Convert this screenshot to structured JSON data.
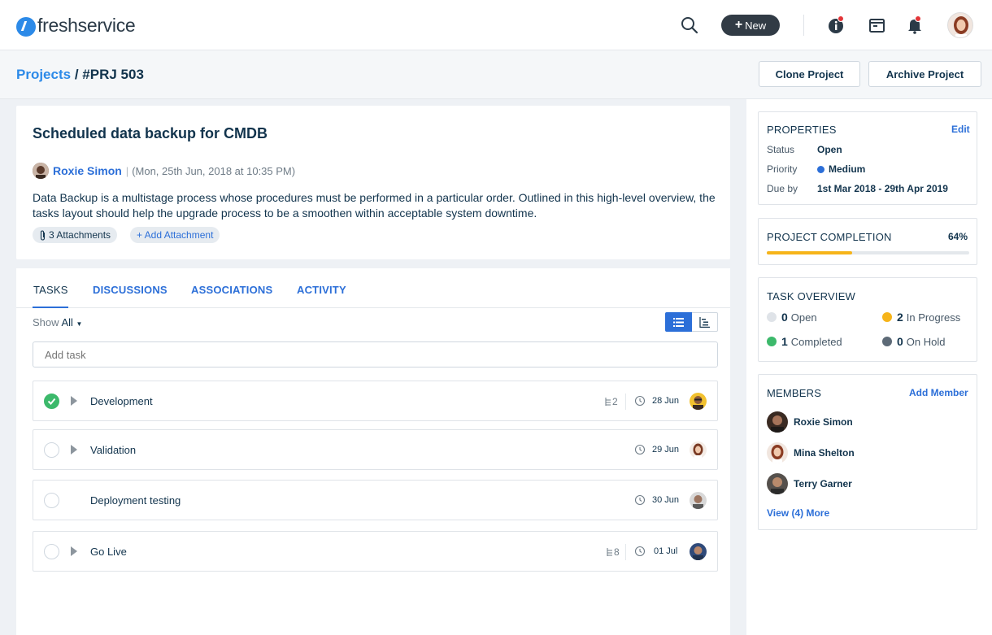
{
  "app": {
    "logo_text": "freshservice",
    "new_label": "New"
  },
  "breadcrumb": {
    "parent": "Projects",
    "separator": "/",
    "current": "#PRJ 503"
  },
  "actions": {
    "clone": "Clone Project",
    "archive": "Archive Project"
  },
  "project": {
    "title": "Scheduled data backup for CMDB",
    "author": "Roxie Simon",
    "separator": "|",
    "date": "(Mon, 25th Jun, 2018 at 10:35 PM)",
    "description": "Data Backup is a multistage process whose procedures must be performed in a particular order. Outlined in this high-level overview, the tasks layout should help the upgrade process to be a smoothen within acceptable system downtime.",
    "attachments": "3 Attachments",
    "add_attachment": "+ Add Attachment"
  },
  "tabs": [
    "TASKS",
    "DISCUSSIONS",
    "ASSOCIATIONS",
    "ACTIVITY"
  ],
  "tasks_panel": {
    "show_label": "Show",
    "show_value": "All",
    "add_placeholder": "Add task",
    "tasks": [
      {
        "name": "Development",
        "done": true,
        "expandable": true,
        "subtasks": "2",
        "date": "28 Jun"
      },
      {
        "name": "Validation",
        "done": false,
        "expandable": true,
        "subtasks": "",
        "date": "29 Jun"
      },
      {
        "name": "Deployment testing",
        "done": false,
        "expandable": false,
        "subtasks": "",
        "date": "30 Jun"
      },
      {
        "name": "Go Live",
        "done": false,
        "expandable": true,
        "subtasks": "8",
        "date": "01 Jul"
      }
    ]
  },
  "properties": {
    "heading": "PROPERTIES",
    "edit": "Edit",
    "status_label": "Status",
    "status": "Open",
    "priority_label": "Priority",
    "priority": "Medium",
    "due_label": "Due by",
    "due": "1st Mar 2018 - 29th Apr 2019"
  },
  "completion": {
    "heading": "PROJECT COMPLETION",
    "percent_label": "64%",
    "percent": 0.42
  },
  "overview": {
    "heading": "TASK OVERVIEW",
    "open_count": "0",
    "open_label": "Open",
    "progress_count": "2",
    "progress_label": "In Progress",
    "completed_count": "1",
    "completed_label": "Completed",
    "hold_count": "0",
    "hold_label": "On Hold"
  },
  "members": {
    "heading": "MEMBERS",
    "add": "Add Member",
    "list": [
      "Roxie Simon",
      "Mina Shelton",
      "Terry Garner"
    ],
    "more": "View (4) More"
  },
  "colors": {
    "brand": "#2c8ae8",
    "link": "#2c6fd8",
    "done": "#3cb96b",
    "in_progress": "#f6b41a",
    "progress_bar": "#f6b41a",
    "alert": "#e43538"
  }
}
